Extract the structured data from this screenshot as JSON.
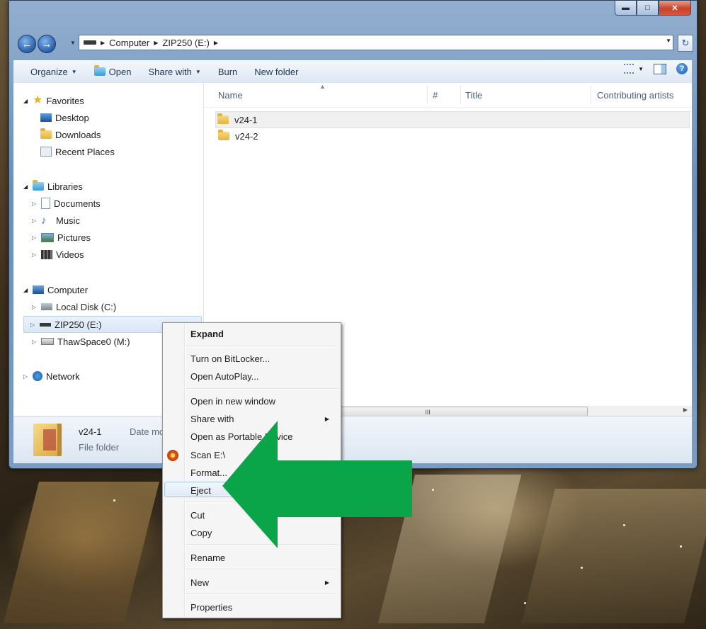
{
  "window": {
    "caption_buttons": {
      "minimize": "▬",
      "maximize": "□",
      "close": "✕"
    }
  },
  "address": {
    "path": [
      "Computer",
      "ZIP250 (E:)"
    ],
    "back_icon": "back-arrow-icon",
    "forward_icon": "forward-arrow-icon"
  },
  "toolbar": {
    "organize": "Organize",
    "open": "Open",
    "share_with": "Share with",
    "burn": "Burn",
    "new_folder": "New folder"
  },
  "nav": {
    "favorites": "Favorites",
    "desktop": "Desktop",
    "downloads": "Downloads",
    "recent_places": "Recent Places",
    "libraries": "Libraries",
    "documents": "Documents",
    "music": "Music",
    "pictures": "Pictures",
    "videos": "Videos",
    "computer": "Computer",
    "local_disk": "Local Disk (C:)",
    "zip250": "ZIP250 (E:)",
    "thawspace": "ThawSpace0 (M:)",
    "network": "Network"
  },
  "columns": {
    "name": "Name",
    "number": "#",
    "title": "Title",
    "contributing_artists": "Contributing artists"
  },
  "files": [
    {
      "name": "v24-1"
    },
    {
      "name": "v24-2"
    }
  ],
  "details": {
    "name": "v24-1",
    "meta": "Date mo",
    "type": "File folder"
  },
  "scrollbar": {
    "thumb_grip": "III"
  },
  "context_menu": {
    "expand": "Expand",
    "bitlocker": "Turn on BitLocker...",
    "autoplay": "Open AutoPlay...",
    "new_window": "Open in new window",
    "share_with": "Share with",
    "portable": "Open as Portable Device",
    "scan": "Scan E:\\",
    "format": "Format...",
    "eject": "Eject",
    "cut": "Cut",
    "copy": "Copy",
    "rename": "Rename",
    "new": "New",
    "properties": "Properties"
  },
  "colors": {
    "arrow": "#0aa548",
    "selection": "#d8e7f7",
    "window_frame": "#7d9cc2"
  }
}
